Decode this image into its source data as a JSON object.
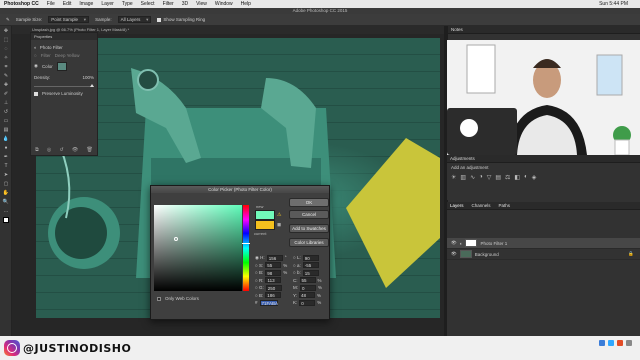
{
  "menubar": {
    "items": [
      "Photoshop CC",
      "File",
      "Edit",
      "Image",
      "Layer",
      "Type",
      "Select",
      "Filter",
      "3D",
      "View",
      "Window",
      "Help"
    ],
    "clock": "Sun 5:44 PM"
  },
  "window_title": "Adobe Photoshop CC 2015",
  "options": {
    "sample_size_label": "Sample Size:",
    "sample_size_value": "Point Sample",
    "sample_label": "Sample:",
    "sample_value": "All Layers",
    "show_ring": "Show Sampling Ring"
  },
  "document_tab": "Unsplash.jpg @ 66.7% (Photo Filter 1, Layer Mask/8) *",
  "properties": {
    "header": "Properties",
    "title": "Photo Filter",
    "filter_label": "Filter",
    "filter_value": "Deep Yellow",
    "color_label": "Color",
    "density_label": "Density:",
    "density_value": "100",
    "density_unit": "%",
    "preserve": "Preserve Luminosity"
  },
  "color_picker": {
    "title": "Color Picker (Photo Filter Color)",
    "ok": "OK",
    "cancel": "Cancel",
    "add_swatches": "Add to Swatches",
    "color_libraries": "Color Libraries",
    "new_label": "new",
    "current_label": "current",
    "only_web": "Only Web Colors",
    "fields": {
      "H": "156",
      "S": "55",
      "Bv": "98",
      "R": "113",
      "G": "250",
      "Bl": "186",
      "L": "90",
      "a": "-55",
      "b": "15",
      "C": "55",
      "M": "0",
      "Y": "48",
      "K": "0",
      "hex": "71FABA"
    }
  },
  "right_panel": {
    "notes_tab": "Notes",
    "adjustments_tab": "Adjustments",
    "add_adjustment": "Add an adjustment",
    "layer_tabs": [
      "Layers",
      "Channels",
      "Paths"
    ],
    "layers": [
      "Photo Filter 1",
      "Background"
    ]
  },
  "watermark": {
    "handle": "@JUSTINODISHO"
  },
  "colors": {
    "accent_new": "#71faba",
    "current": "#f4c01e",
    "teal_overlay": "#2a5d50"
  }
}
